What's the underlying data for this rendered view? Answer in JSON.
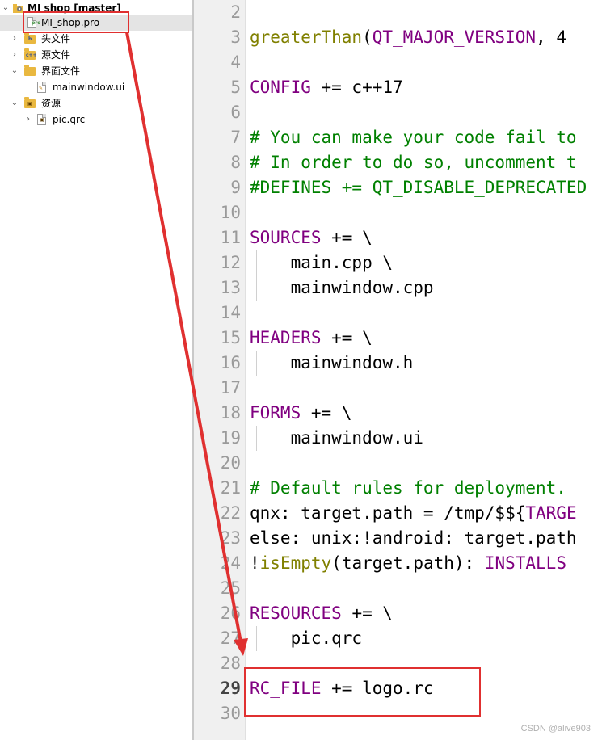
{
  "tree": {
    "items": [
      {
        "label": "MI shop [master]",
        "icon": "qt-project-icon"
      },
      {
        "label": "MI_shop.pro",
        "icon": "pro-file-icon"
      },
      {
        "label": "头文件",
        "icon": "header-folder-icon"
      },
      {
        "label": "源文件",
        "icon": "source-folder-icon"
      },
      {
        "label": "界面文件",
        "icon": "form-folder-icon"
      },
      {
        "label": "mainwindow.ui",
        "icon": "ui-file-icon"
      },
      {
        "label": "资源",
        "icon": "resource-folder-icon"
      },
      {
        "label": "pic.qrc",
        "icon": "qrc-file-icon"
      }
    ]
  },
  "editor": {
    "current_line": 29,
    "lines": [
      {
        "n": "2",
        "parts": []
      },
      {
        "n": "3",
        "parts": [
          {
            "c": "fn",
            "t": "greaterThan"
          },
          {
            "c": "pl",
            "t": "("
          },
          {
            "c": "var",
            "t": "QT_MAJOR_VERSION"
          },
          {
            "c": "pl",
            "t": ", 4"
          }
        ]
      },
      {
        "n": "4",
        "parts": []
      },
      {
        "n": "5",
        "parts": [
          {
            "c": "var",
            "t": "CONFIG"
          },
          {
            "c": "pl",
            "t": " += c++17"
          }
        ]
      },
      {
        "n": "6",
        "parts": []
      },
      {
        "n": "7",
        "parts": [
          {
            "c": "cm",
            "t": "# You can make your code fail to"
          }
        ]
      },
      {
        "n": "8",
        "parts": [
          {
            "c": "cm",
            "t": "# In order to do so, uncomment t"
          }
        ]
      },
      {
        "n": "9",
        "parts": [
          {
            "c": "cm",
            "t": "#DEFINES += QT_DISABLE_DEPRECATED"
          }
        ]
      },
      {
        "n": "10",
        "parts": []
      },
      {
        "n": "11",
        "parts": [
          {
            "c": "var",
            "t": "SOURCES"
          },
          {
            "c": "pl",
            "t": " += \\"
          }
        ]
      },
      {
        "n": "12",
        "parts": [
          {
            "c": "pl",
            "t": "    main.cpp \\"
          }
        ],
        "guide": true
      },
      {
        "n": "13",
        "parts": [
          {
            "c": "pl",
            "t": "    mainwindow.cpp"
          }
        ],
        "guide": true
      },
      {
        "n": "14",
        "parts": []
      },
      {
        "n": "15",
        "parts": [
          {
            "c": "var",
            "t": "HEADERS"
          },
          {
            "c": "pl",
            "t": " += \\"
          }
        ]
      },
      {
        "n": "16",
        "parts": [
          {
            "c": "pl",
            "t": "    mainwindow.h"
          }
        ],
        "guide": true
      },
      {
        "n": "17",
        "parts": []
      },
      {
        "n": "18",
        "parts": [
          {
            "c": "var",
            "t": "FORMS"
          },
          {
            "c": "pl",
            "t": " += \\"
          }
        ]
      },
      {
        "n": "19",
        "parts": [
          {
            "c": "pl",
            "t": "    mainwindow.ui"
          }
        ],
        "guide": true
      },
      {
        "n": "20",
        "parts": []
      },
      {
        "n": "21",
        "parts": [
          {
            "c": "cm",
            "t": "# Default rules for deployment."
          }
        ]
      },
      {
        "n": "22",
        "parts": [
          {
            "c": "pl",
            "t": "qnx: target.path = /tmp/$${"
          },
          {
            "c": "var",
            "t": "TARGE"
          }
        ]
      },
      {
        "n": "23",
        "parts": [
          {
            "c": "pl",
            "t": "else: unix:!android: target.path"
          }
        ]
      },
      {
        "n": "24",
        "parts": [
          {
            "c": "pl",
            "t": "!"
          },
          {
            "c": "fn",
            "t": "isEmpty"
          },
          {
            "c": "pl",
            "t": "(target.path): "
          },
          {
            "c": "var",
            "t": "INSTALLS"
          }
        ]
      },
      {
        "n": "25",
        "parts": []
      },
      {
        "n": "26",
        "parts": [
          {
            "c": "var",
            "t": "RESOURCES"
          },
          {
            "c": "pl",
            "t": " += \\"
          }
        ]
      },
      {
        "n": "27",
        "parts": [
          {
            "c": "pl",
            "t": "    pic.qrc"
          }
        ],
        "guide": true
      },
      {
        "n": "28",
        "parts": []
      },
      {
        "n": "29",
        "parts": [
          {
            "c": "var",
            "t": "RC_FILE"
          },
          {
            "c": "pl",
            "t": " += logo.rc"
          }
        ]
      },
      {
        "n": "30",
        "parts": []
      }
    ]
  },
  "annotations": {
    "color": "#e03030"
  },
  "watermark": "CSDN @alive903",
  "colors": {
    "variable": "#800080",
    "function": "#808000",
    "comment": "#008000",
    "selection": "#e4e4e4"
  }
}
